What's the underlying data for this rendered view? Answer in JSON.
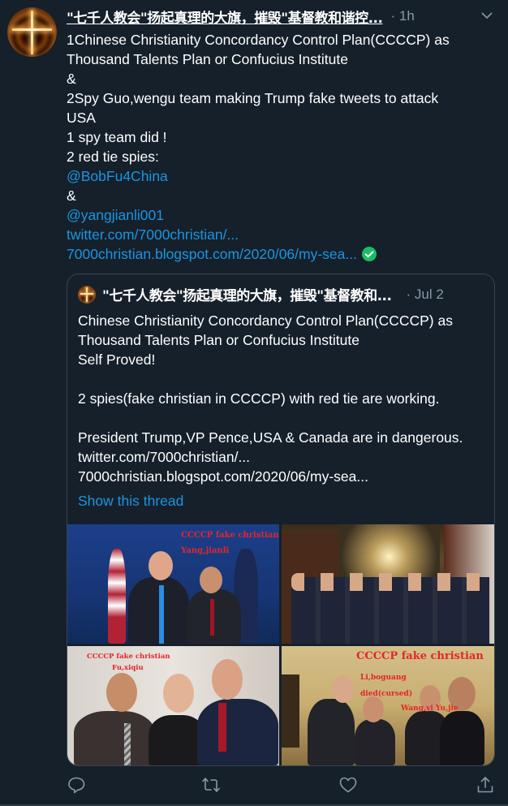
{
  "tweet": {
    "author_name": "\"七千人教会\"扬起真理的大旗，摧毁\"基督教和谐控...",
    "separator": "·",
    "time": "1h",
    "lines": [
      {
        "text": "1Chinese Christianity Concordancy Control Plan(CCCCP)  as",
        "type": "text"
      },
      {
        "text": "Thousand Talents Plan or Confucius Institute",
        "type": "text"
      },
      {
        "text": "&",
        "type": "text"
      },
      {
        "text": "2Spy Guo,wengu team making Trump fake tweets to  attack",
        "type": "text"
      },
      {
        "text": "USA",
        "type": "text"
      },
      {
        "text": "1 spy team did !",
        "type": "text"
      },
      {
        "text": "2 red tie spies:",
        "type": "text"
      },
      {
        "text": "@BobFu4China",
        "type": "link"
      },
      {
        "text": "&",
        "type": "text"
      },
      {
        "text": "@yangjianli001",
        "type": "link"
      },
      {
        "text": "twitter.com/7000christian/...",
        "type": "link"
      },
      {
        "text": "7000christian.blogspot.com/2020/06/my-sea...",
        "type": "link"
      }
    ],
    "verified_icon": "check-circle-icon"
  },
  "quoted": {
    "author_name": "\"七千人教会\"扬起真理的大旗，摧毁\"基督教和...",
    "separator": "·",
    "time": "Jul 2",
    "lines": [
      "Chinese Christianity Concordancy Control Plan(CCCCP) as",
      "Thousand Talents Plan or Confucius Institute",
      "Self Proved!",
      "",
      "2 spies(fake christian in CCCCP)  with red tie are working.",
      "",
      "President Trump,VP Pence,USA & Canada are in dangerous.",
      "twitter.com/7000christian/...",
      "7000christian.blogspot.com/2020/06/my-sea..."
    ],
    "show_thread": "Show this thread",
    "photos": [
      {
        "caption_1": "CCCCP fake christian",
        "caption_2": "Yang,jianli"
      },
      {
        "caption_1": "",
        "caption_2": ""
      },
      {
        "caption_1": "CCCCP fake christian",
        "caption_2": "Fu,xiqiu"
      },
      {
        "caption_1": "CCCCP fake christian",
        "caption_2": "Li,boguang",
        "caption_3": "died(cursed)",
        "caption_4": "Wang,yi  Yu,jie"
      }
    ]
  },
  "actions": {
    "reply": "reply-icon",
    "retweet": "retweet-icon",
    "like": "like-icon",
    "share": "share-icon"
  },
  "colors": {
    "background": "#15202b",
    "link": "#1b95e0",
    "muted": "#8899a6",
    "border": "#38444d",
    "verified": "#17bf63",
    "caption_red": "#e3262a"
  }
}
